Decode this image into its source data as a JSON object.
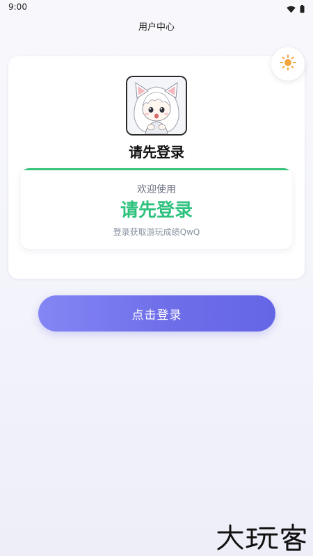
{
  "status_bar": {
    "time": "9:00",
    "icons": [
      "wifi-icon",
      "battery-icon"
    ]
  },
  "header": {
    "title": "用户中心"
  },
  "theme_toggle": {
    "icon": "sun-icon",
    "color": "#f2a53c"
  },
  "profile": {
    "avatar": "anime-cat-girl-avatar",
    "username": "请先登录"
  },
  "welcome_card": {
    "greeting": "欢迎使用",
    "title": "请先登录",
    "subtitle": "登录获取游玩成绩QwQ",
    "accent_color": "#36c27a",
    "title_color": "#2ec27e"
  },
  "login_button": {
    "label": "点击登录",
    "color": "#6f6ee9"
  },
  "watermark": {
    "text": "大玩客"
  }
}
